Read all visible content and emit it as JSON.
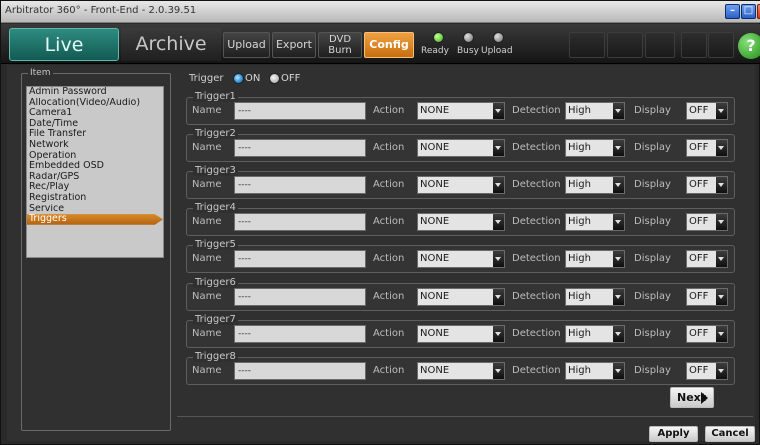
{
  "window": {
    "title": "Arbitrator 360° - Front-End - 2.0.39.51"
  },
  "toolbar": {
    "live_label": "Live",
    "archive_label": "Archive",
    "upload_label": "Upload",
    "export_label": "Export",
    "dvd_label_line1": "DVD",
    "dvd_label_line2": "Burn",
    "config_label": "Config",
    "status": {
      "ready": "Ready",
      "busy": "Busy",
      "upload": "Upload"
    },
    "help_label": "?"
  },
  "sidebar": {
    "legend": "Item",
    "items": [
      {
        "label": "Admin Password"
      },
      {
        "label": "Allocation(Video/Audio)"
      },
      {
        "label": "Camera1"
      },
      {
        "label": "Date/Time"
      },
      {
        "label": "File Transfer"
      },
      {
        "label": "Network"
      },
      {
        "label": "Operation"
      },
      {
        "label": "Embedded OSD"
      },
      {
        "label": "Radar/GPS"
      },
      {
        "label": "Rec/Play"
      },
      {
        "label": "Registration"
      },
      {
        "label": "Service"
      },
      {
        "label": "Triggers"
      }
    ],
    "selected_index": 12
  },
  "trigger_switch": {
    "label": "Trigger",
    "on_label": "ON",
    "off_label": "OFF",
    "selected": "ON"
  },
  "field_labels": {
    "name": "Name",
    "action": "Action",
    "detection": "Detection",
    "display": "Display"
  },
  "triggers": [
    {
      "title": "Trigger1",
      "name": "----",
      "action": "NONE",
      "detection": "High",
      "display": "OFF"
    },
    {
      "title": "Trigger2",
      "name": "----",
      "action": "NONE",
      "detection": "High",
      "display": "OFF"
    },
    {
      "title": "Trigger3",
      "name": "----",
      "action": "NONE",
      "detection": "High",
      "display": "OFF"
    },
    {
      "title": "Trigger4",
      "name": "----",
      "action": "NONE",
      "detection": "High",
      "display": "OFF"
    },
    {
      "title": "Trigger5",
      "name": "----",
      "action": "NONE",
      "detection": "High",
      "display": "OFF"
    },
    {
      "title": "Trigger6",
      "name": "----",
      "action": "NONE",
      "detection": "High",
      "display": "OFF"
    },
    {
      "title": "Trigger7",
      "name": "----",
      "action": "NONE",
      "detection": "High",
      "display": "OFF"
    },
    {
      "title": "Trigger8",
      "name": "----",
      "action": "NONE",
      "detection": "High",
      "display": "OFF"
    }
  ],
  "buttons": {
    "next": "Next",
    "apply": "Apply",
    "cancel": "Cancel"
  }
}
